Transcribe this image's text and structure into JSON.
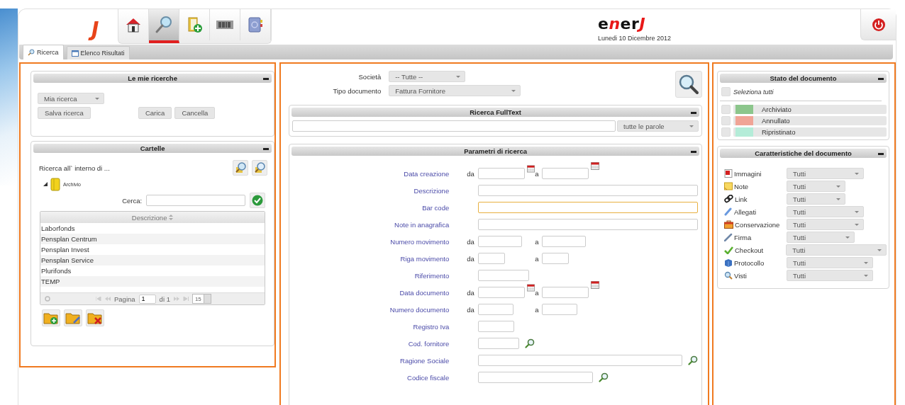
{
  "header": {
    "app_mark": "J",
    "tools": [
      {
        "kind": "home",
        "selected": false
      },
      {
        "kind": "search",
        "selected": true
      },
      {
        "kind": "folder-add",
        "selected": false
      },
      {
        "kind": "barcode",
        "selected": false
      },
      {
        "kind": "address-book",
        "selected": false
      }
    ],
    "brand": [
      {
        "text": "e",
        "accent": false
      },
      {
        "text": "n",
        "accent": true
      },
      {
        "text": "er",
        "accent": false
      },
      {
        "text": "J",
        "accent": true
      }
    ],
    "date": "Lunedi 10 Dicembre 2012"
  },
  "tabs": [
    {
      "label": "Ricerca",
      "kind": "search",
      "selected": true
    },
    {
      "label": "Elenco Risultati",
      "kind": "list",
      "selected": false
    }
  ],
  "saved_searches": {
    "title": "Le mie ricerche",
    "dropdown": "Mia ricerca",
    "buttons": [
      "Salva ricerca",
      "Carica",
      "Cancella"
    ]
  },
  "folders": {
    "title": "Cartelle",
    "scope_label": "Ricerca all` interno di ...",
    "tree": [
      {
        "label": "Archivio",
        "expanded": true
      }
    ],
    "search_label": "Cerca:",
    "column": "Descrizione",
    "rows": [
      "Laborfonds",
      "Pensplan Centrum",
      "Pensplan Invest",
      "Pensplan Service",
      "Plurifonds",
      "TEMP"
    ],
    "pager": {
      "label": "Pagina",
      "page": "1",
      "total": "di 1",
      "page_size": "15"
    }
  },
  "filters": [
    {
      "label": "Società",
      "value": "-- Tutte --"
    },
    {
      "label": "Tipo documento",
      "value": "Fattura Fornitore"
    }
  ],
  "fulltext": {
    "title": "Ricerca FullText",
    "mode": "tutte le parole"
  },
  "params": {
    "title": "Parametri di ricerca",
    "fields": [
      {
        "label": "Data creazione",
        "kind": "date-range",
        "from": "da",
        "to": "a",
        "focused": false
      },
      {
        "label": "Descrizione",
        "kind": "text",
        "focused": false
      },
      {
        "label": "Bar code",
        "kind": "text",
        "focused": true
      },
      {
        "label": "Note in anagrafica",
        "kind": "text",
        "focused": false
      },
      {
        "label": "Numero movimento",
        "kind": "range",
        "from": "da",
        "to": "a",
        "focused": false
      },
      {
        "label": "Riga movimento",
        "kind": "range",
        "from": "da",
        "to": "a",
        "focused": false
      },
      {
        "label": "Riferimento",
        "kind": "text",
        "focused": false
      },
      {
        "label": "Data documento",
        "kind": "date-range",
        "from": "da",
        "to": "a",
        "focused": false
      },
      {
        "label": "Numero documento",
        "kind": "range",
        "from": "da",
        "to": "a",
        "focused": false
      },
      {
        "label": "Registro Iva",
        "kind": "text",
        "focused": false
      },
      {
        "label": "Cod. fornitore",
        "kind": "lookup",
        "focused": false
      },
      {
        "label": "Ragione Sociale",
        "kind": "lookup",
        "focused": false
      },
      {
        "label": "Codice fiscale",
        "kind": "lookup",
        "focused": false
      }
    ]
  },
  "status": {
    "title": "Stato del documento",
    "select_all": {
      "label": "Seleziona tutti",
      "checked": false
    },
    "items": [
      {
        "label": "Archiviato",
        "color": "#8cc68c",
        "checked": false
      },
      {
        "label": "Annullato",
        "color": "#f0a496",
        "checked": false
      },
      {
        "label": "Ripristinato",
        "color": "#b4ecd8",
        "checked": false
      }
    ]
  },
  "features": {
    "title": "Caratteristiche del documento",
    "items": [
      {
        "label": "Immagini",
        "kind": "image",
        "value": "Tutti"
      },
      {
        "label": "Note",
        "kind": "note",
        "value": "Tutti"
      },
      {
        "label": "Link",
        "kind": "link",
        "value": "Tutti"
      },
      {
        "label": "Allegati",
        "kind": "attachment",
        "value": "Tutti"
      },
      {
        "label": "Conservazione",
        "kind": "archive",
        "value": "Tutti"
      },
      {
        "label": "Firma",
        "kind": "signature",
        "value": "Tutti"
      },
      {
        "label": "Checkout",
        "kind": "checkout",
        "value": "Tutti"
      },
      {
        "label": "Protocollo",
        "kind": "protocol",
        "value": "Tutti"
      },
      {
        "label": "Visti",
        "kind": "seen",
        "value": "Tutti"
      }
    ]
  }
}
